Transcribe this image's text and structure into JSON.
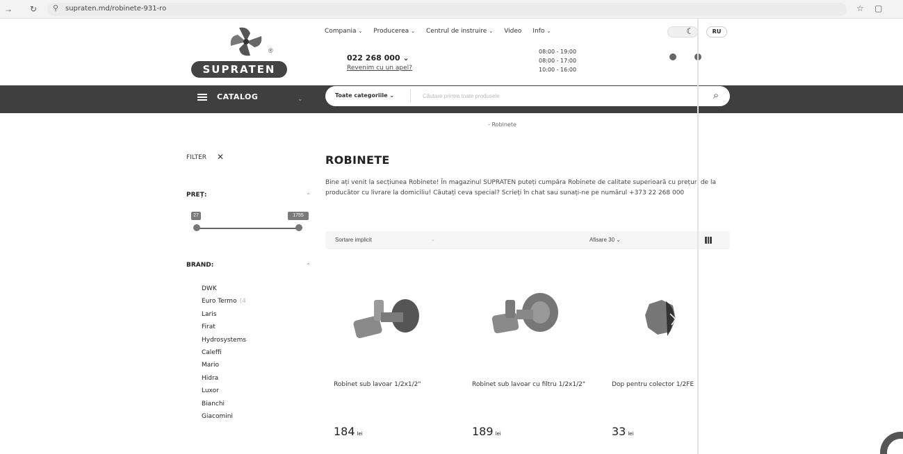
{
  "browser": {
    "url": "supraten.md/robinete-931-ro"
  },
  "header": {
    "logo_text": "SUPRATEN",
    "logo_mark": "®",
    "nav": [
      {
        "label": "Compania"
      },
      {
        "label": "Producerea"
      },
      {
        "label": "Centrul de instruire"
      },
      {
        "label": "Video"
      },
      {
        "label": "Info"
      }
    ],
    "lang": "RU",
    "phone": "022 268 000 ⌄",
    "callback": "Revenim cu un apel?",
    "hours": [
      "08:00 - 19:00",
      "08:00 - 17:00",
      "10:00 - 16:00"
    ]
  },
  "catalog_bar": {
    "catalog_label": "CATALOG",
    "category_select": "Toate categoriile",
    "search_placeholder": "Căutare printre toate produsele"
  },
  "breadcrumb": {
    "current": "Robinete"
  },
  "sidebar": {
    "filter_label": "FILTER",
    "price_title": "PREȚ:",
    "price_min": "27",
    "price_max": "1755",
    "brand_title": "BRAND:",
    "brands": [
      {
        "name": "DWK",
        "count": ""
      },
      {
        "name": "Euro Termo",
        "count": "(4"
      },
      {
        "name": "Laris",
        "count": ""
      },
      {
        "name": "Firat",
        "count": ""
      },
      {
        "name": "Hydrosystems",
        "count": ""
      },
      {
        "name": "Caleffi",
        "count": ""
      },
      {
        "name": "Mario",
        "count": ""
      },
      {
        "name": "Hidra",
        "count": ""
      },
      {
        "name": "Luxor",
        "count": ""
      },
      {
        "name": "Bianchi",
        "count": ""
      },
      {
        "name": "Giacomini",
        "count": ""
      }
    ]
  },
  "main": {
    "title": "ROBINETE",
    "intro": "Bine ați venit la secțiunea Robinete! În magazinul SUPRATEN puteți cumpăra Robinete de calitate superioară cu prețuri de la producător cu livrare la domiciliu! Căutați ceva special? Scrieți în chat sau sunați-ne pe numărul +373 22 268 000",
    "sort_label": "Sortare implicit",
    "show_label": "Afisare 30",
    "products": [
      {
        "name": "Robinet sub lavoar 1/2x1/2\"",
        "price": "184",
        "currency": "lei"
      },
      {
        "name": "Robinet sub lavoar cu filtru 1/2x1/2\"",
        "price": "189",
        "currency": "lei"
      },
      {
        "name": "Dop pentru colector 1/2FE",
        "price": "33",
        "currency": "lei"
      }
    ]
  },
  "colors": {
    "dark_bar": "#3f3f3f",
    "logo_bg": "#444444"
  }
}
